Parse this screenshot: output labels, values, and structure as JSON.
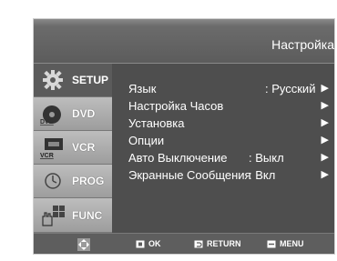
{
  "header": {
    "title": "Настройка"
  },
  "sidebar": {
    "tabs": [
      {
        "label": "SETUP",
        "icon": "gear-icon",
        "active": true
      },
      {
        "label": "DVD",
        "icon": "dvd-disc-icon",
        "badge": "DVD",
        "active": false
      },
      {
        "label": "VCR",
        "icon": "vcr-cassette-icon",
        "badge": "VCR",
        "active": false
      },
      {
        "label": "PROG",
        "icon": "clock-icon",
        "active": false
      },
      {
        "label": "FUNC",
        "icon": "function-hand-icon",
        "active": false
      }
    ]
  },
  "menu": {
    "items": [
      {
        "label": "Язык",
        "value": ": Русский"
      },
      {
        "label": "Настройка Часов",
        "value": ""
      },
      {
        "label": "Установка",
        "value": ""
      },
      {
        "label": "Опции",
        "value": ""
      },
      {
        "label": "Авто Выключение",
        "value": ": Выкл"
      },
      {
        "label": "Экранные Сообщения",
        "value": ": Вкл"
      }
    ],
    "arrow": "▶"
  },
  "footer": {
    "ok": "OK",
    "return": "RETURN",
    "menu": "MENU"
  },
  "colors": {
    "panel": "#4e4e4e",
    "sidebar_inactive": "#b0b0b0",
    "text": "#ffffff"
  }
}
